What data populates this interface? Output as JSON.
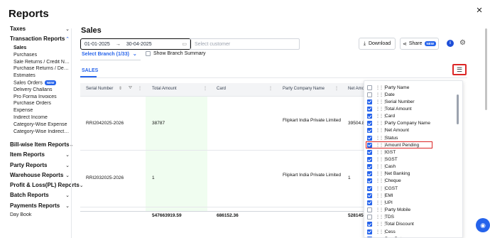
{
  "header": {
    "title": "Reports",
    "close_icon": "×"
  },
  "sidebar": {
    "sections": [
      {
        "label": "Taxes",
        "chevron": "⌄"
      },
      {
        "label": "Transaction Reports",
        "chevron": "⌃"
      },
      {
        "label": "Bill-wise Item Reports",
        "chevron": "⌄"
      },
      {
        "label": "Item Reports",
        "chevron": "⌄"
      },
      {
        "label": "Party Reports",
        "chevron": "⌄"
      },
      {
        "label": "Warehouse Reports",
        "chevron": "⌄"
      },
      {
        "label": "Profit & Loss(PL) Reports",
        "chevron": "⌄"
      },
      {
        "label": "Batch Reports",
        "chevron": "⌄"
      },
      {
        "label": "Payments Reports",
        "chevron": "⌄"
      }
    ],
    "transaction_items": [
      "Sales",
      "Purchases",
      "Sale Returns / Credit Notes",
      "Purchase Returns / Debit Notes",
      "Estimates",
      "Sales Orders",
      "Delivery Challans",
      "Pro Forma Invoices",
      "Purchase Orders",
      "Expense",
      "Indirect Income",
      "Category-Wise Expense",
      "Category-Wise Indirect Income"
    ],
    "new_badge": "NEW",
    "day_book": "Day Book"
  },
  "main": {
    "title": "Sales",
    "date_from": "01-01-2025",
    "date_arrow": "→",
    "date_to": "30-04-2025",
    "customer_placeholder": "Select customer",
    "download_label": "Download",
    "share_label": "Share",
    "share_badge": "NEW",
    "branch_label": "Select Branch (1/33)",
    "show_branch_summary": "Show Branch Summary",
    "tab_sales": "SALES"
  },
  "table": {
    "columns": [
      "Serial Number",
      "Total Amount",
      "Card",
      "Party Company Name",
      "Net Amo"
    ],
    "rows": [
      {
        "serial": "RRI2042025-2026",
        "total": "38787",
        "card": "",
        "party": "Flipkart India Private Limited",
        "net": "39504.8"
      },
      {
        "serial": "RRI2032025-2026",
        "total": "1",
        "card": "",
        "party": "Flipkart India Private Limited",
        "net": "1"
      }
    ],
    "totals": {
      "total": "547663919.59",
      "card": "686152.36",
      "net": "528145"
    }
  },
  "column_picker": {
    "items": [
      {
        "label": "Party Name",
        "checked": false
      },
      {
        "label": "Date",
        "checked": false
      },
      {
        "label": "Serial Number",
        "checked": true
      },
      {
        "label": "Total Amount",
        "checked": true
      },
      {
        "label": "Card",
        "checked": true
      },
      {
        "label": "Party Company Name",
        "checked": true
      },
      {
        "label": "Net Amount",
        "checked": true
      },
      {
        "label": "Status",
        "checked": true
      },
      {
        "label": "Amount Pending",
        "checked": true,
        "highlighted": true
      },
      {
        "label": "IGST",
        "checked": true
      },
      {
        "label": "SGST",
        "checked": true
      },
      {
        "label": "Cash",
        "checked": true
      },
      {
        "label": "Net Banking",
        "checked": true
      },
      {
        "label": "Cheque",
        "checked": true
      },
      {
        "label": "CGST",
        "checked": true
      },
      {
        "label": "EMI",
        "checked": true
      },
      {
        "label": "UPI",
        "checked": true
      },
      {
        "label": "Party Mobile",
        "checked": false
      },
      {
        "label": "TDS",
        "checked": false
      },
      {
        "label": "Total Discount",
        "checked": true
      },
      {
        "label": "Cess",
        "checked": true
      },
      {
        "label": "Due Date",
        "checked": true
      }
    ]
  },
  "colors": {
    "accent": "#2563eb",
    "highlight": "#dc2626"
  }
}
